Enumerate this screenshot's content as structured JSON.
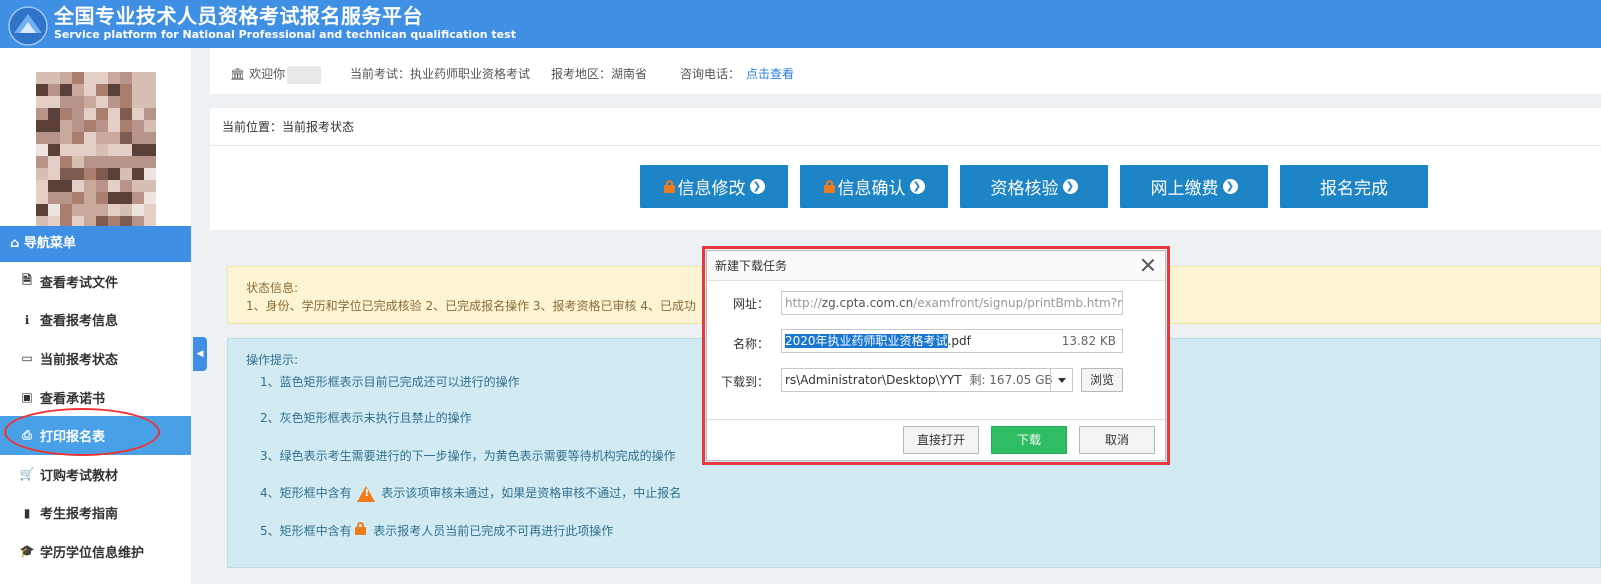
{
  "header": {
    "title_cn": "全国专业技术人员资格考试报名服务平台",
    "title_en": "Service platform for National Professional and technican qualification test",
    "logo_text": "PTA"
  },
  "infobar": {
    "welcome": "欢迎你",
    "exam_label": "当前考试：",
    "exam_value": "执业药师职业资格考试",
    "region_label": "报考地区：",
    "region_value": "湖南省",
    "phone_label": "咨询电话：",
    "phone_link": "点击查看"
  },
  "breadcrumb": "当前位置：当前报考状态",
  "steps": [
    {
      "label": "信息修改",
      "locked": true
    },
    {
      "label": "信息确认",
      "locked": true
    },
    {
      "label": "资格核验",
      "locked": false
    },
    {
      "label": "网上缴费",
      "locked": false
    },
    {
      "label": "报名完成",
      "locked": false
    }
  ],
  "sidebar": {
    "menu_header": "导航菜单",
    "items": [
      {
        "label": "查看考试文件",
        "icon": "file-icon"
      },
      {
        "label": "查看报考信息",
        "icon": "info-icon"
      },
      {
        "label": "当前报考状态",
        "icon": "monitor-icon"
      },
      {
        "label": "查看承诺书",
        "icon": "card-icon"
      },
      {
        "label": "打印报名表",
        "icon": "print-icon"
      },
      {
        "label": "订购考试教材",
        "icon": "cart-icon"
      },
      {
        "label": "考生报考指南",
        "icon": "book-icon"
      },
      {
        "label": "学历学位信息维护",
        "icon": "graduation-cap-icon"
      }
    ]
  },
  "status": {
    "title": "状态信息:",
    "text": "1、身份、学历和学位已完成核验 2、已完成报名操作 3、报考资格已审核 4、已成功"
  },
  "ops": {
    "title": "操作提示:",
    "line1": "1、蓝色矩形框表示目前已完成还可以进行的操作",
    "line2": "2、灰色矩形框表示未执行且禁止的操作",
    "line3": "3、绿色表示考生需要进行的下一步操作，为黄色表示需要等待机构完成的操作",
    "line4_a": "4、矩形框中含有",
    "line4_b": "表示该项审核未通过，如果是资格审核不通过，中止报名",
    "line5_a": "5、矩形框中含有",
    "line5_b": "表示报考人员当前已完成不可再进行此项操作"
  },
  "dialog": {
    "title": "新建下载任务",
    "url_label": "网址：",
    "url_prefix": "http://",
    "url_host": "zg.cpta.com.cn",
    "url_path": "/examfront/signup/printBmb.htm?myr",
    "name_label": "名称：",
    "name_selected": "2020年执业药师职业资格考试",
    "name_ext": ".pdf",
    "size": "13.82 KB",
    "saveto_label": "下载到：",
    "saveto_path": "rs\\Administrator\\Desktop\\YYT",
    "free_space": "剩: 167.05 GB",
    "browse": "浏览",
    "open_direct": "直接打开",
    "download": "下载",
    "cancel": "取消"
  }
}
